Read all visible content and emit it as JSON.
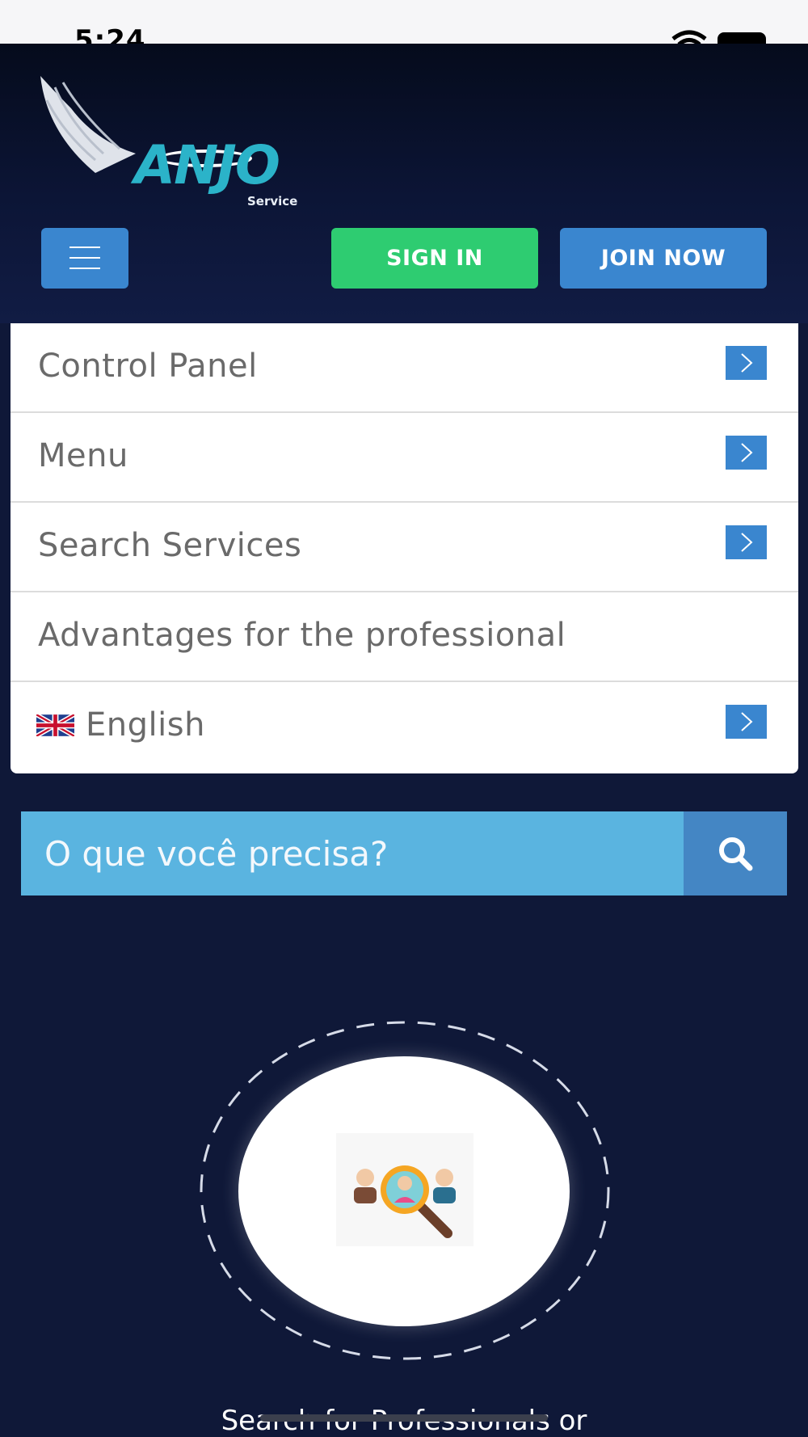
{
  "status_bar": {
    "time": "5:24"
  },
  "header": {
    "logo": {
      "text": "ANJO",
      "subtext": "Service"
    },
    "signin_label": "SIGN IN",
    "join_label": "JOIN NOW"
  },
  "menu": {
    "items": [
      {
        "label": "Control Panel",
        "has_chevron": true
      },
      {
        "label": "Menu",
        "has_chevron": true
      },
      {
        "label": "Search Services",
        "has_chevron": true
      },
      {
        "label": "Advantages for the professional",
        "has_chevron": false
      },
      {
        "label": "English",
        "has_chevron": true,
        "icon": "uk-flag-icon"
      }
    ]
  },
  "search": {
    "placeholder": "O que você precisa?"
  },
  "caption": "Search for Professionals or",
  "colors": {
    "header_bg": "#0c1536",
    "page_bg": "#0f1838",
    "signin": "#2ecc71",
    "join": "#3a86cf",
    "search_input": "#5ab4e0",
    "search_button": "#4486c4"
  }
}
